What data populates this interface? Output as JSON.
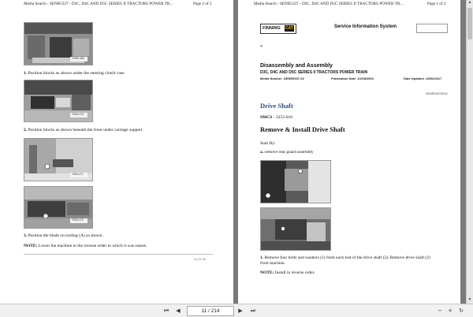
{
  "left_page": {
    "header_left": "Media Search - SENR5337 - D3C, D4C AND D5C SERIES II TRACTORS POWER TR...",
    "header_right": "Page 2 of 2",
    "photo_tags": [
      "T05M-460",
      "T050-470",
      "T050-471",
      "T050-472"
    ],
    "step1_num": "1.",
    "step1_text": " Position blocks as shown under the steering clutch case.",
    "step2_num": "2.",
    "step2_text": " Position blocks as shown beneath the front under carriage support.",
    "step3_num": "3.",
    "step3_text": " Position the blade on tooling (A) as shown.",
    "note_label": "NOTE:",
    "note_text": " Lower the machine in the reverse order in which it was raised.",
    "footer_stamp": "11-21-99"
  },
  "right_page": {
    "header_left": "Media Search - SENR5337 - D3C, D4C AND D5C SERIES II TRACTORS POWER TR...",
    "header_right": "Page 1 of 2",
    "logo_text": "FINNING",
    "logo_cat": "CAT",
    "service_system": "Service Information System",
    "marker": "«",
    "doc_title": "Disassembly and Assembly",
    "doc_subtitle": "D3C, D4C AND D5C SERIES II TRACTORS POWER TRAIN",
    "media_number": "Media Number -SENR5337-02",
    "publication_date": "Publication Date -01/08/2004",
    "date_updated": "Date Updated -15/02/2017",
    "doc_id": "SENR53370016",
    "section_title": "Drive Shaft",
    "smcs_label": "SMCS",
    "smcs_value": " - 3253-010",
    "procedure_title": "Remove & Install Drive Shaft",
    "start_by": "Start By:",
    "start_item_label": "a.",
    "start_item_text": " remove rear guard assembly",
    "step1_num": "1.",
    "step1_text": " Remove four bolts and washers (1) from each end of the drive shaft (2). Remove drive shaft (2)",
    "step1_text2": "from machine.",
    "note_label": "NOTE:",
    "note_text": " Install in reverse order."
  },
  "toolbar": {
    "page_indicator": "11 / 214",
    "first_icon": "first-page-icon",
    "prev_icon": "previous-page-icon",
    "next_icon": "next-page-icon",
    "last_icon": "last-page-icon"
  }
}
